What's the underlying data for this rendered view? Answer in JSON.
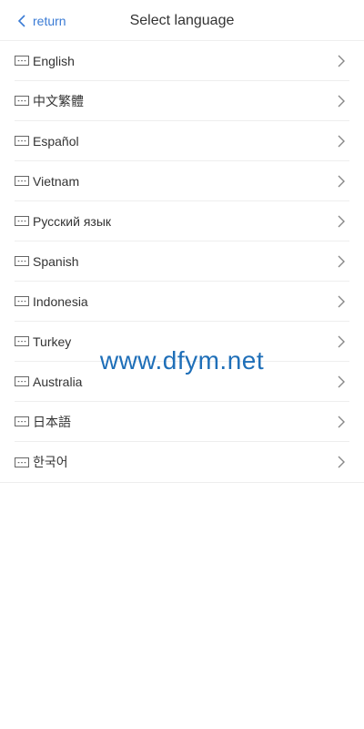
{
  "header": {
    "back_label": "return",
    "title": "Select language"
  },
  "languages": [
    {
      "label": "English"
    },
    {
      "label": "中文繁體"
    },
    {
      "label": "Español"
    },
    {
      "label": "Vietnam"
    },
    {
      "label": "Русский язык"
    },
    {
      "label": "Spanish"
    },
    {
      "label": "Indonesia"
    },
    {
      "label": "Turkey"
    },
    {
      "label": "Australia"
    },
    {
      "label": "日本語"
    },
    {
      "label": "한국어"
    }
  ],
  "watermark": "www.dfym.net",
  "icons": {
    "back": "chevron-left-icon",
    "row_item": "message-icon",
    "row_arrow": "chevron-right-icon"
  },
  "colors": {
    "accent": "#3a7bd5",
    "text": "#333333",
    "divider": "#eeeeee",
    "watermark": "#1f6fb8"
  }
}
